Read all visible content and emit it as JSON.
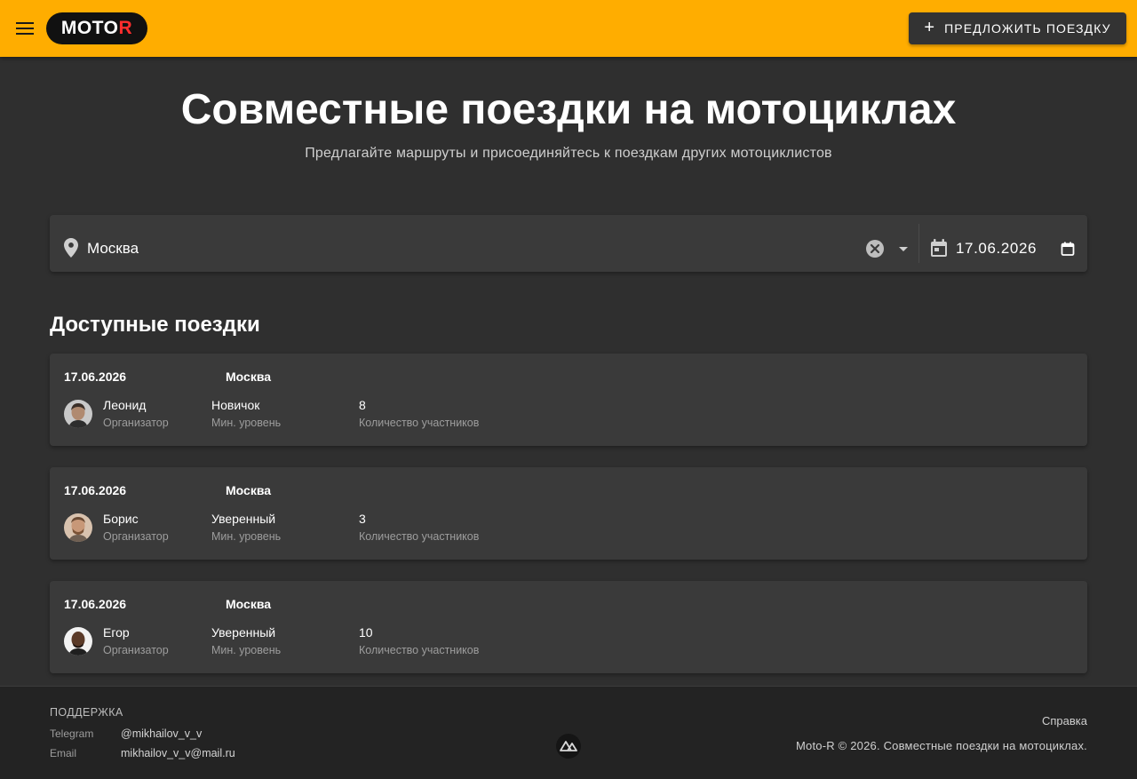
{
  "header": {
    "logo_main": "MOTO",
    "logo_accent": "R",
    "offer_button_icon": "plus-icon",
    "offer_button_label": "ПРЕДЛОЖИТЬ ПОЕЗДКУ",
    "background_color": "#ffad00"
  },
  "hero": {
    "title": "Совместные поездки на мотоциклах",
    "subtitle": "Предлагайте маршруты и присоединяйтесь к поездкам других мотоциклистов"
  },
  "filters": {
    "city_value": "Москва",
    "date_value": "17.06.2026"
  },
  "trips_section": {
    "title": "Доступные поездки",
    "organizer_label": "Организатор",
    "level_label": "Мин. уровень",
    "participants_label": "Количество участников",
    "trips": [
      {
        "date": "17.06.2026",
        "city": "Москва",
        "organizer": "Леонид",
        "level": "Новичок",
        "participants": "8"
      },
      {
        "date": "17.06.2026",
        "city": "Москва",
        "organizer": "Борис",
        "level": "Уверенный",
        "participants": "3"
      },
      {
        "date": "17.06.2026",
        "city": "Москва",
        "organizer": "Егор",
        "level": "Уверенный",
        "participants": "10"
      }
    ]
  },
  "footer": {
    "support_title": "ПОДДЕРЖКА",
    "telegram_label": "Telegram",
    "telegram_value": "@mikhailov_v_v",
    "email_label": "Email",
    "email_value": "mikhailov_v_v@mail.ru",
    "help_link": "Справка",
    "copyright": "Moto-R © 2026. Совместные поездки на мотоциклах."
  }
}
